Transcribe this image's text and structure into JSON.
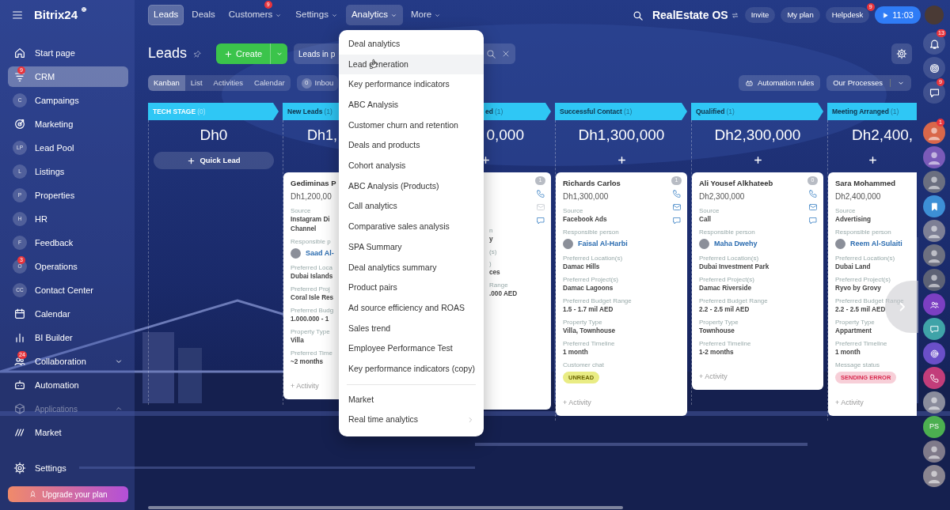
{
  "sidebar": {
    "logo": "Bitrix24",
    "items": [
      {
        "kind": "link",
        "label": "Start page",
        "selected": false
      },
      {
        "kind": "link",
        "label": "CRM",
        "badge": "9",
        "selected": true
      },
      {
        "kind": "link",
        "label": "Campaings",
        "initials": "C",
        "selected": false
      },
      {
        "kind": "link",
        "label": "Marketing",
        "selected": false
      },
      {
        "kind": "link",
        "label": "Lead Pool",
        "initials": "LP",
        "selected": false
      },
      {
        "kind": "link",
        "label": "Listings",
        "initials": "L",
        "selected": false
      },
      {
        "kind": "link",
        "label": "Properties",
        "initials": "P",
        "selected": false
      },
      {
        "kind": "link",
        "label": "HR",
        "initials": "H",
        "selected": false
      },
      {
        "kind": "link",
        "label": "Feedback",
        "initials": "F",
        "selected": false
      },
      {
        "kind": "link",
        "label": "Operations",
        "initials": "O",
        "badge": "3",
        "selected": false
      },
      {
        "kind": "link",
        "label": "Contact Center",
        "initials": "CC",
        "selected": false
      },
      {
        "kind": "link",
        "label": "Calendar",
        "selected": false
      },
      {
        "kind": "link",
        "label": "BI Builder",
        "selected": false
      },
      {
        "kind": "group",
        "label": "Collaboration",
        "badge": "24",
        "expanded": false,
        "selected": false
      },
      {
        "kind": "link",
        "label": "Automation",
        "selected": false
      },
      {
        "kind": "section",
        "label": "Applications",
        "expanded": true,
        "selected": false
      },
      {
        "kind": "link",
        "label": "Market",
        "selected": false
      }
    ],
    "settings": "Settings",
    "upgrade": "Upgrade your plan"
  },
  "topbar": {
    "tabs": [
      {
        "label": "Leads",
        "selected": true,
        "expanded": false
      },
      {
        "label": "Deals",
        "selected": false,
        "expanded": false
      },
      {
        "label": "Customers",
        "badge": "9",
        "caret": true,
        "selected": false,
        "expanded": false
      },
      {
        "label": "Settings",
        "caret": true,
        "selected": false,
        "expanded": false
      },
      {
        "label": "Analytics",
        "caret": true,
        "selected": false,
        "expanded": true
      },
      {
        "label": "More",
        "caret": true,
        "selected": false,
        "expanded": false
      }
    ],
    "workspace": "RealEstate OS",
    "buttons": [
      {
        "label": "Invite"
      },
      {
        "label": "My plan"
      },
      {
        "label": "Helpdesk",
        "badge": "9"
      }
    ],
    "timer": "11:03"
  },
  "toolbar": {
    "title": "Leads",
    "create": "Create",
    "filter": "Leads in p"
  },
  "views": [
    {
      "label": "Kanban",
      "selected": true
    },
    {
      "label": "List",
      "selected": false
    },
    {
      "label": "Activities",
      "selected": false
    },
    {
      "label": "Calendar",
      "selected": false
    }
  ],
  "inbox": {
    "count": "0",
    "label": "Inbou"
  },
  "actions": {
    "automation": "Automation rules",
    "processes": "Our Processes"
  },
  "analytics_menu": {
    "items": [
      {
        "label": "Deal analytics",
        "highlighted": false
      },
      {
        "label": "Lead generation",
        "highlighted": true
      },
      {
        "label": "Key performance indicators",
        "highlighted": false
      },
      {
        "label": "ABC Analysis",
        "highlighted": false
      },
      {
        "label": "Customer churn and retention",
        "highlighted": false
      },
      {
        "label": "Deals and products",
        "highlighted": false
      },
      {
        "label": "Cohort analysis",
        "highlighted": false
      },
      {
        "label": "ABC Analysis (Products)",
        "highlighted": false
      },
      {
        "label": "Call analytics",
        "highlighted": false
      },
      {
        "label": "Comparative sales analysis",
        "highlighted": false
      },
      {
        "label": "SPA Summary",
        "highlighted": false
      },
      {
        "label": "Deal analytics summary",
        "highlighted": false
      },
      {
        "label": "Product pairs",
        "highlighted": false
      },
      {
        "label": "Ad source efficiency and ROAS",
        "highlighted": false
      },
      {
        "label": "Sales trend",
        "highlighted": false
      },
      {
        "label": "Employee Performance Test",
        "highlighted": false
      },
      {
        "label": "Key performance indicators (copy)",
        "highlighted": false
      }
    ],
    "extra": [
      {
        "label": "Market",
        "submenu": false
      },
      {
        "label": "Real time analytics",
        "submenu": true
      }
    ]
  },
  "columns": [
    {
      "kind": "system",
      "name": "TECH STAGE",
      "count": "(0)",
      "amount": "Dh0",
      "quick_add": "Quick Lead"
    },
    {
      "kind": "stage",
      "name": "New Leads",
      "count": "(1)",
      "amount": "Dh1,",
      "card": {
        "kind": "full",
        "lines": [
          {
            "kind": "name",
            "text": "Gediminas P"
          },
          {
            "kind": "amount",
            "text": "Dh1,200,00"
          },
          {
            "kind": "label",
            "text": "Source"
          },
          {
            "kind": "value",
            "text": "Instagram Di"
          },
          {
            "kind": "value",
            "text": "Channel"
          },
          {
            "kind": "label",
            "text": "Responsible p"
          },
          {
            "kind": "person",
            "text": "Saad Al-"
          },
          {
            "kind": "label",
            "text": "Preferred Loca"
          },
          {
            "kind": "value",
            "text": "Dubai Islands"
          },
          {
            "kind": "label",
            "text": "Preferred Proj"
          },
          {
            "kind": "value",
            "text": "Coral Isle Res"
          },
          {
            "kind": "label",
            "text": "Preferred Budg"
          },
          {
            "kind": "value",
            "text": "1.000.000 - 1"
          },
          {
            "kind": "label",
            "text": "Property Type"
          },
          {
            "kind": "value",
            "text": "Villa"
          },
          {
            "kind": "label",
            "text": "Preferred Time"
          },
          {
            "kind": "value",
            "text": "~2 months"
          },
          {
            "kind": "activity",
            "text": "+ Activity"
          }
        ]
      }
    },
    {
      "kind": "covered",
      "name": "ed",
      "count": "(1)",
      "amount": "0,000",
      "card": {
        "kind": "partial",
        "counter": "1",
        "contact_icons": {
          "email_active": false
        },
        "lines": [
          {
            "kind": "label",
            "text": "n"
          },
          {
            "kind": "value",
            "text": "y"
          },
          {
            "kind": "label",
            "text": "(s)"
          },
          {
            "kind": "label",
            "text": ")"
          },
          {
            "kind": "value",
            "text": "ces"
          },
          {
            "kind": "label",
            "text": "Range"
          },
          {
            "kind": "value",
            "text": ".000 AED"
          }
        ]
      }
    },
    {
      "kind": "stage",
      "name": "Successful Contact",
      "count": "(1)",
      "amount": "Dh1,300,000",
      "card": {
        "kind": "full",
        "counter": "1",
        "contact_icons": {
          "email_active": true
        },
        "lines": [
          {
            "kind": "name",
            "text": "Richards Carlos"
          },
          {
            "kind": "amount",
            "text": "Dh1,300,000"
          },
          {
            "kind": "label",
            "text": "Source"
          },
          {
            "kind": "value",
            "text": "Facebook Ads"
          },
          {
            "kind": "label",
            "text": "Responsible person"
          },
          {
            "kind": "person",
            "text": "Faisal Al-Harbi"
          },
          {
            "kind": "label",
            "text": "Preferred Location(s)"
          },
          {
            "kind": "value",
            "text": "Damac Hills"
          },
          {
            "kind": "label",
            "text": "Preferred Project(s)"
          },
          {
            "kind": "value",
            "text": "Damac Lagoons"
          },
          {
            "kind": "label",
            "text": "Preferred Budget Range"
          },
          {
            "kind": "value",
            "text": "1.5 - 1.7 mil AED"
          },
          {
            "kind": "label",
            "text": "Property Type"
          },
          {
            "kind": "value",
            "text": "Villa, Townhouse"
          },
          {
            "kind": "label",
            "text": "Preferred Timeline"
          },
          {
            "kind": "value",
            "text": "1 month"
          },
          {
            "kind": "label",
            "text": "Customer chat"
          },
          {
            "kind": "unread",
            "text": "UNREAD"
          },
          {
            "kind": "activity",
            "text": "+ Activity"
          }
        ]
      }
    },
    {
      "kind": "stage",
      "name": "Qualified",
      "count": "(1)",
      "amount": "Dh2,300,000",
      "card": {
        "kind": "full",
        "counter": "0",
        "contact_icons": {
          "email_active": true
        },
        "lines": [
          {
            "kind": "name",
            "text": "Ali Yousef Alkhateeb"
          },
          {
            "kind": "amount",
            "text": "Dh2,300,000"
          },
          {
            "kind": "label",
            "text": "Source"
          },
          {
            "kind": "value",
            "text": "Call"
          },
          {
            "kind": "label",
            "text": "Responsible person"
          },
          {
            "kind": "person",
            "text": "Maha Dwehy"
          },
          {
            "kind": "label",
            "text": "Preferred Location(s)"
          },
          {
            "kind": "value",
            "text": "Dubai Investment Park"
          },
          {
            "kind": "label",
            "text": "Preferred Project(s)"
          },
          {
            "kind": "value",
            "text": "Damac Riverside"
          },
          {
            "kind": "label",
            "text": "Preferred Budget Range"
          },
          {
            "kind": "value",
            "text": "2.2 - 2.5 mil AED"
          },
          {
            "kind": "label",
            "text": "Property Type"
          },
          {
            "kind": "value",
            "text": "Townhouse"
          },
          {
            "kind": "label",
            "text": "Preferred Timeline"
          },
          {
            "kind": "value",
            "text": "1-2 months"
          },
          {
            "kind": "activity",
            "text": "+ Activity"
          }
        ]
      }
    },
    {
      "kind": "cut",
      "name": "Meeting Arranged",
      "count": "(1)",
      "amount": "Dh2,400,",
      "card": {
        "kind": "full",
        "lines": [
          {
            "kind": "name",
            "text": "Sara Mohammed"
          },
          {
            "kind": "amount",
            "text": "Dh2,400,000"
          },
          {
            "kind": "label",
            "text": "Source"
          },
          {
            "kind": "value",
            "text": "Advertising"
          },
          {
            "kind": "label",
            "text": "Responsible person"
          },
          {
            "kind": "person",
            "text": "Reem Al-Sulaiti"
          },
          {
            "kind": "label",
            "text": "Preferred Location(s)"
          },
          {
            "kind": "value",
            "text": "Dubai Land"
          },
          {
            "kind": "label",
            "text": "Preferred Project(s)"
          },
          {
            "kind": "value",
            "text": "Ryvo by Grovy"
          },
          {
            "kind": "label",
            "text": "Preferred Budget Range"
          },
          {
            "kind": "value",
            "text": "2.2 - 2.5 mil AED"
          },
          {
            "kind": "label",
            "text": "Property Type"
          },
          {
            "kind": "value",
            "text": "Appartment"
          },
          {
            "kind": "label",
            "text": "Preferred Timeline"
          },
          {
            "kind": "value",
            "text": "1 month"
          },
          {
            "kind": "label",
            "text": "Message status"
          },
          {
            "kind": "error",
            "text": "SENDING ERROR"
          },
          {
            "kind": "activity",
            "text": "+ Activity"
          }
        ]
      }
    }
  ],
  "rail": [
    {
      "kind": "tool",
      "badge": "13"
    },
    {
      "kind": "tool"
    },
    {
      "kind": "tool",
      "badge": "9"
    },
    {
      "kind": "avatar",
      "color": "#d9674a",
      "badge": "1"
    },
    {
      "kind": "avatar",
      "color": "#7a5ab8"
    },
    {
      "kind": "avatar",
      "color": "#6b6f80"
    },
    {
      "kind": "bubble",
      "color": "#3d8fd6"
    },
    {
      "kind": "avatar",
      "color": "#7d7f95"
    },
    {
      "kind": "avatar",
      "color": "#6d7080"
    },
    {
      "kind": "avatar",
      "color": "#5d6275"
    },
    {
      "kind": "bubble",
      "color": "#7b3fc2"
    },
    {
      "kind": "bubble",
      "color": "#3fa3a8"
    },
    {
      "kind": "bubble",
      "color": "#6a4fc8"
    },
    {
      "kind": "bubble",
      "color": "#c23d7a"
    },
    {
      "kind": "avatar",
      "color": "#8a8c9c"
    },
    {
      "kind": "initials",
      "text": "PS",
      "color": "#4caf50"
    },
    {
      "kind": "avatar",
      "color": "#7f7a8a"
    },
    {
      "kind": "avatar",
      "color": "#8a8590"
    }
  ]
}
